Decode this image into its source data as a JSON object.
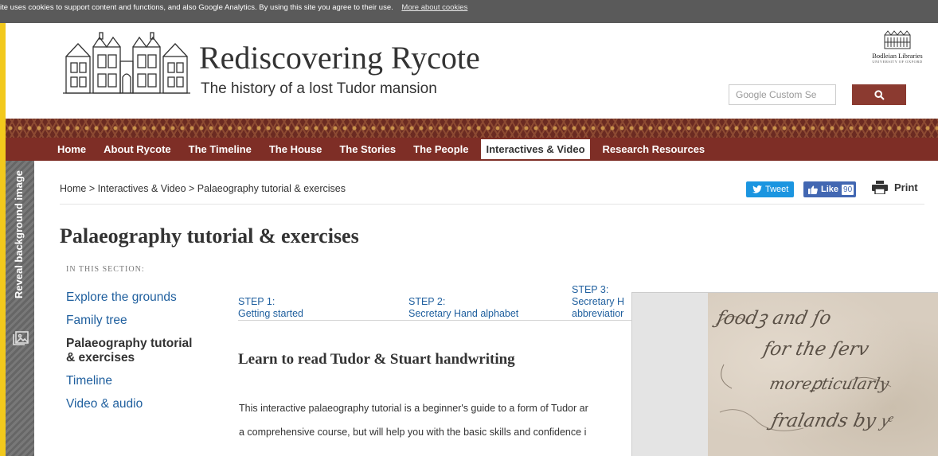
{
  "cookie_bar": {
    "message": "ite uses cookies to support content and functions, and also Google Analytics. By using this site you agree to their use.",
    "link": "More about cookies"
  },
  "header": {
    "title": "Rediscovering Rycote",
    "subtitle": "The history of a lost Tudor mansion",
    "partner_logo": {
      "name": "Bodleian Libraries",
      "sub": "UNIVERSITY OF OXFORD"
    },
    "search": {
      "placeholder": "Google Custom Se",
      "button_icon": "search-icon"
    }
  },
  "nav": {
    "items": [
      {
        "label": "Home",
        "active": false
      },
      {
        "label": "About Rycote",
        "active": false
      },
      {
        "label": "The Timeline",
        "active": false
      },
      {
        "label": "The House",
        "active": false
      },
      {
        "label": "The Stories",
        "active": false
      },
      {
        "label": "The People",
        "active": false
      },
      {
        "label": "Interactives & Video",
        "active": true
      },
      {
        "label": "Research Resources",
        "active": false
      }
    ]
  },
  "side_tab": {
    "label": "Reveal background image"
  },
  "breadcrumb": "Home > Interactives & Video > Palaeography tutorial & exercises",
  "share": {
    "tweet": "Tweet",
    "like": "Like",
    "like_count": "90",
    "print": "Print"
  },
  "page_title": "Palaeography tutorial & exercises",
  "section_nav": {
    "heading": "IN THIS SECTION:",
    "items": [
      {
        "label": "Explore the grounds",
        "current": false
      },
      {
        "label": "Family tree",
        "current": false
      },
      {
        "label": "Palaeography tutorial & exercises",
        "current": true
      },
      {
        "label": "Timeline",
        "current": false
      },
      {
        "label": "Video & audio",
        "current": false
      }
    ]
  },
  "steps": [
    {
      "label": "STEP 1:",
      "title": "Getting started"
    },
    {
      "label": "STEP 2:",
      "title": "Secretary Hand alphabet"
    },
    {
      "label": "STEP 3:",
      "title_line1": "Secretary H",
      "title_line2": "abbreviatior"
    }
  ],
  "content": {
    "subheading": "Learn to read Tudor & Stuart handwriting",
    "paragraph_line1": "This interactive palaeography tutorial is a beginner's guide to a form of Tudor ar",
    "paragraph_line2": "a comprehensive course, but will help you with the basic skills and confidence i"
  },
  "colors": {
    "frame": "#f2c91c",
    "nav_background": "#7e2e26",
    "search_button": "#8b3a30",
    "link": "#1f5f9e",
    "tweet": "#1b95e0",
    "facebook": "#4267b2"
  }
}
